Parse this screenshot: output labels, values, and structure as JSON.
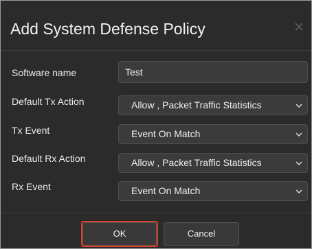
{
  "dialog": {
    "title": "Add System Defense Policy",
    "close_icon": "close-icon"
  },
  "form": {
    "software_name": {
      "label": "Software name",
      "value": "Test"
    },
    "default_tx_action": {
      "label": "Default Tx Action",
      "selected": "Allow , Packet Traffic Statistics"
    },
    "tx_event": {
      "label": "Tx Event",
      "selected": "Event On Match"
    },
    "default_rx_action": {
      "label": "Default Rx Action",
      "selected": "Allow , Packet Traffic Statistics"
    },
    "rx_event": {
      "label": "Rx Event",
      "selected": "Event On Match"
    }
  },
  "footer": {
    "ok_label": "OK",
    "cancel_label": "Cancel"
  },
  "colors": {
    "dialog_background": "#2b2b2b",
    "field_background": "#3b3b3b",
    "highlight": "#d9412b"
  }
}
